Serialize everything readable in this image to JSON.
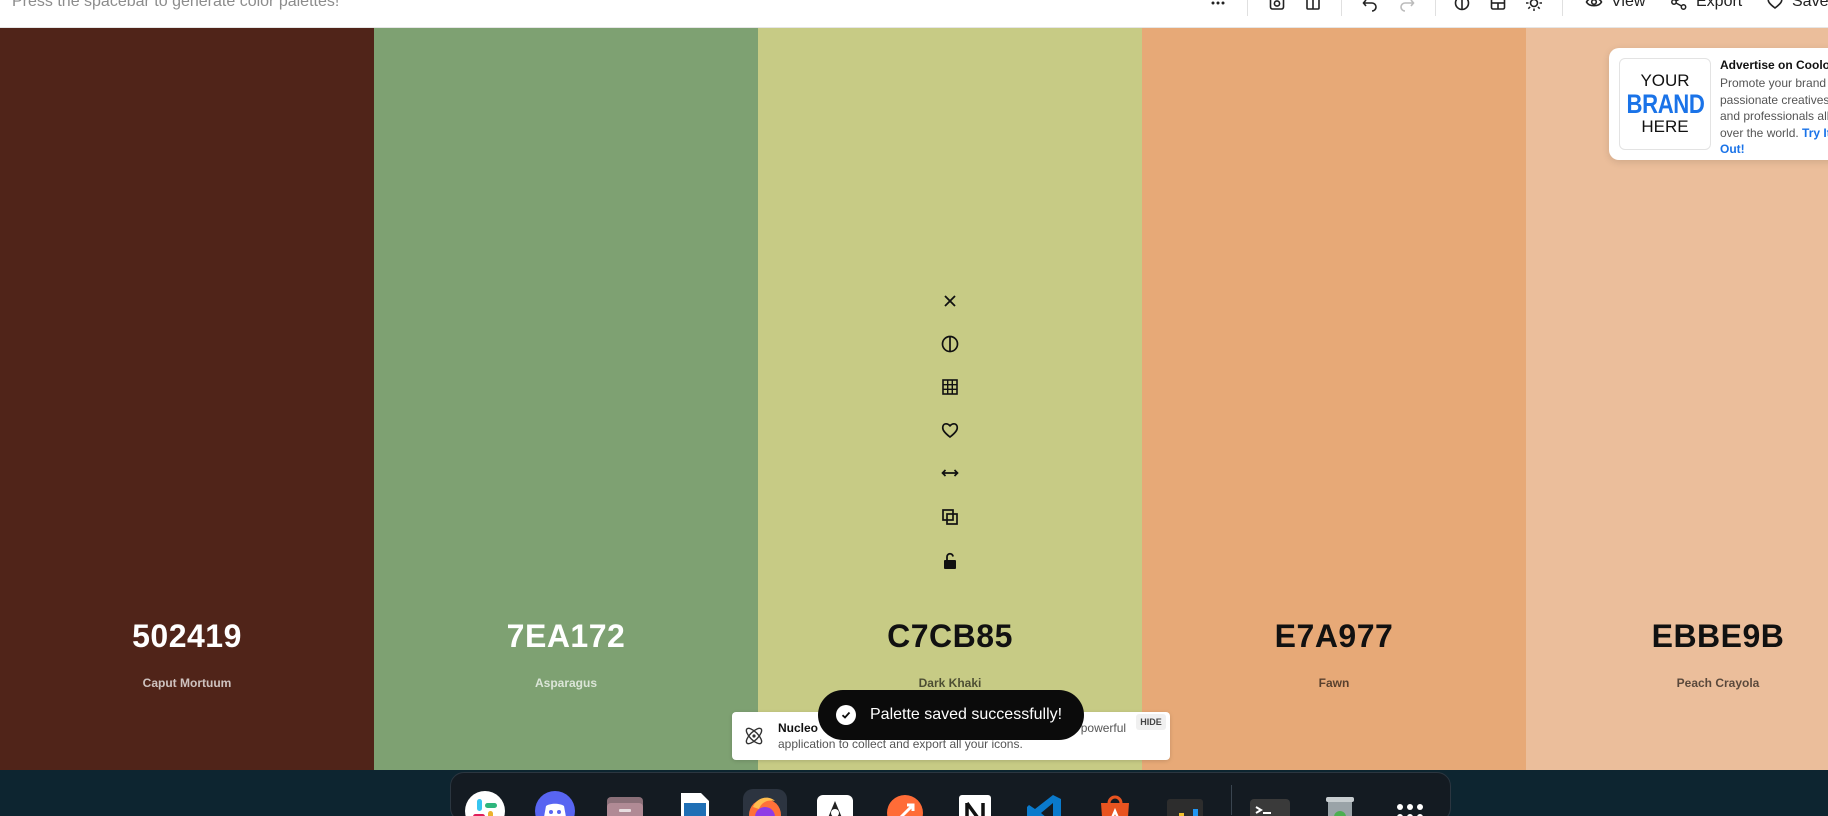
{
  "topbar": {
    "hint": "Press the spacebar to generate color palettes!",
    "view_label": "View",
    "export_label": "Export",
    "save_label": "Save"
  },
  "palette": [
    {
      "hex": "502419",
      "name": "Caput Mortuum",
      "color": "#502419",
      "text_tone": "light"
    },
    {
      "hex": "7EA172",
      "name": "Asparagus",
      "color": "#7EA172",
      "text_tone": "light"
    },
    {
      "hex": "C7CB85",
      "name": "Dark Khaki",
      "color": "#C7CB85",
      "text_tone": "dark"
    },
    {
      "hex": "E7A977",
      "name": "Fawn",
      "color": "#E7A977",
      "text_tone": "dark"
    },
    {
      "hex": "EBBE9B",
      "name": "Peach Crayola",
      "color": "#EBBE9B",
      "text_tone": "dark"
    }
  ],
  "column_tools": [
    "close-icon",
    "contrast-icon",
    "shades-grid-icon",
    "heart-icon",
    "drag-icon",
    "copy-icon",
    "unlock-icon"
  ],
  "ad": {
    "logo_line1": "YOUR",
    "logo_line2": "BRAND",
    "logo_line3": "HERE",
    "title": "Advertise on Coolors",
    "text": "Promote your brand to passionate creatives and professionals all over the world.",
    "link": "Try It Out!"
  },
  "promo": {
    "title": "Nucleo",
    "text_tail": "and a powerful application to collect and export all your icons.",
    "hide_label": "HIDE"
  },
  "toast": {
    "message": "Palette saved successfully!"
  },
  "dock": {
    "apps": [
      "slack-icon",
      "discord-icon",
      "files-icon",
      "libreoffice-impress-icon",
      "firefox-icon",
      "inkscape-icon",
      "postman-icon",
      "notion-icon",
      "vscode-icon",
      "app-center-icon",
      "system-monitor-icon",
      "terminal-icon",
      "trash-icon",
      "show-apps-icon"
    ],
    "active_app": "firefox-icon"
  },
  "colors": {
    "accent": "#1a73e8",
    "toast_bg": "#0b0b0b",
    "desktop_bg": "#0d2530"
  }
}
